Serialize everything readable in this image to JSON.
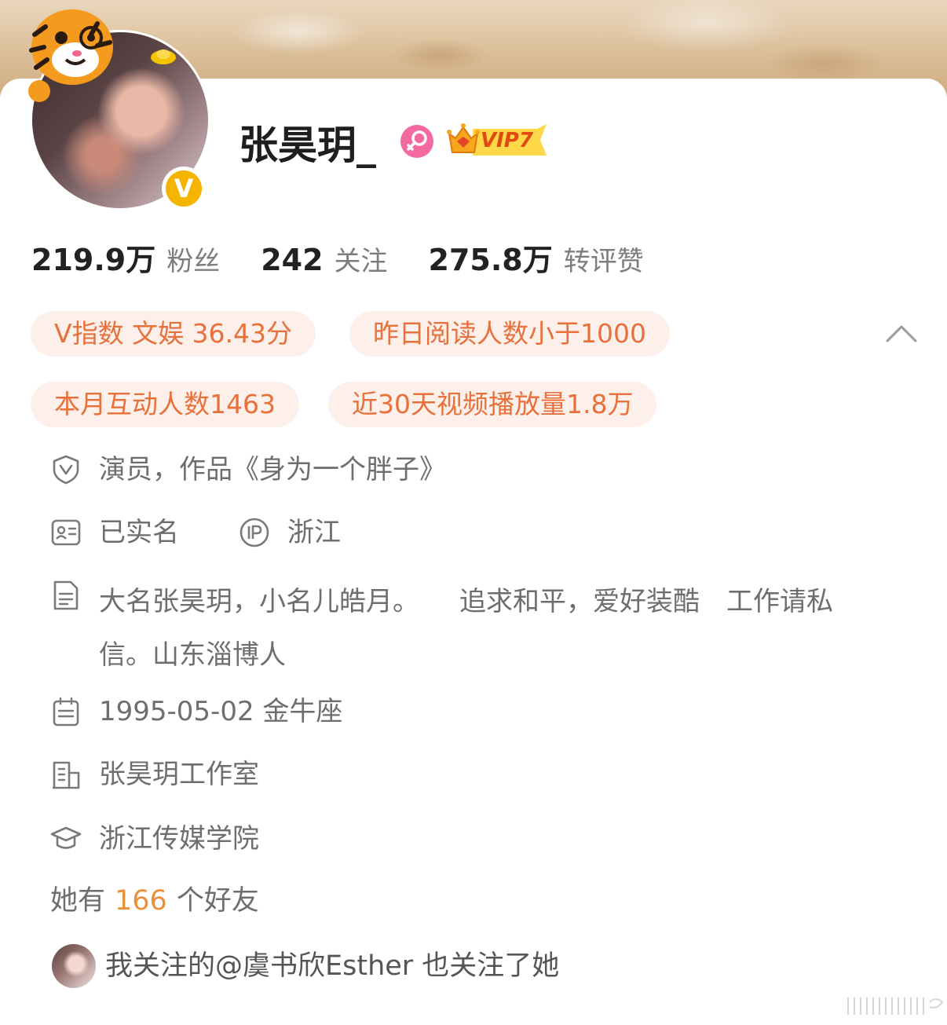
{
  "profile": {
    "username": "张昊玥_",
    "vip_label": "VIP7",
    "verified_badge": "V",
    "gender_icon": "female-icon"
  },
  "stats": {
    "followers_value": "219.9万",
    "followers_label": "粉丝",
    "following_value": "242",
    "following_label": "关注",
    "interactions_value": "275.8万",
    "interactions_label": "转评赞"
  },
  "tags": [
    "V指数 文娱 36.43分",
    "昨日阅读人数小于1000",
    "本月互动人数1463",
    "近30天视频播放量1.8万"
  ],
  "info": {
    "verification": "演员，作品《身为一个胖子》",
    "real_name": "已实名",
    "ip_location": "浙江",
    "bio": "大名张昊玥，小名儿皓月。　　追求和平，爱好装酷　工作请私信。山东淄博人",
    "birthday": "1995-05-02 金牛座",
    "company": "张昊玥工作室",
    "school": "浙江传媒学院"
  },
  "friends": {
    "prefix": "她有",
    "count": "166",
    "suffix": "个好友"
  },
  "mutual": {
    "text": "我关注的@虞书欣Esther 也关注了她"
  },
  "colors": {
    "accent": "#e8703a",
    "tag_bg": "#fdf0ea",
    "count_orange": "#e8903a",
    "verify_yellow": "#f4b400",
    "female_pink": "#f46aa0"
  }
}
